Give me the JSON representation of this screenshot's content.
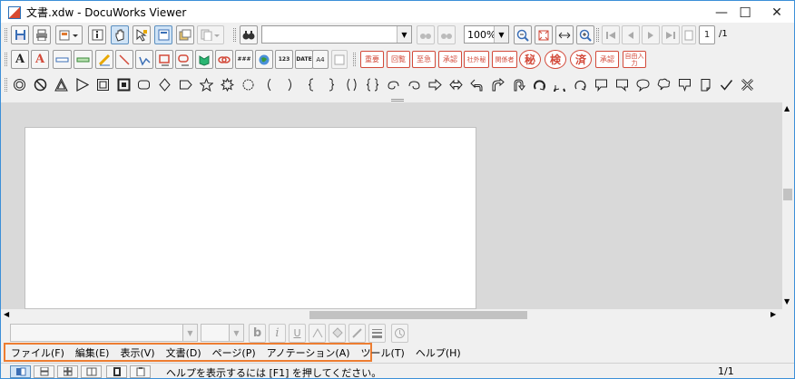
{
  "window": {
    "title": "文書.xdw - DocuWorks Viewer"
  },
  "title_controls": {
    "minimize": "—",
    "maximize": "☐",
    "close": "✕"
  },
  "toolbar1": {
    "search_input": "",
    "zoom_value": "100%",
    "page_input": "1",
    "page_total": "/1"
  },
  "stamps": [
    "重要",
    "回覧",
    "至急",
    "承認",
    "社外秘",
    "関係者",
    "秘",
    "検",
    "済",
    "承認",
    "自由入力"
  ],
  "format_bar": {
    "font_name": "",
    "font_size": "",
    "bold": "b",
    "italic": "i",
    "underline": "U"
  },
  "menu": [
    "ファイル(F)",
    "編集(E)",
    "表示(V)",
    "文書(D)",
    "ページ(P)",
    "アノテーション(A)",
    "ツール(T)",
    "ヘルプ(H)"
  ],
  "status": {
    "message": "ヘルプを表示するには [F1] を押してください。",
    "page": "1/1"
  },
  "colors": {
    "stamp_red": "#d34a3a",
    "menu_highlight": "#ed7d31",
    "active_button": "#cfe3f6"
  }
}
